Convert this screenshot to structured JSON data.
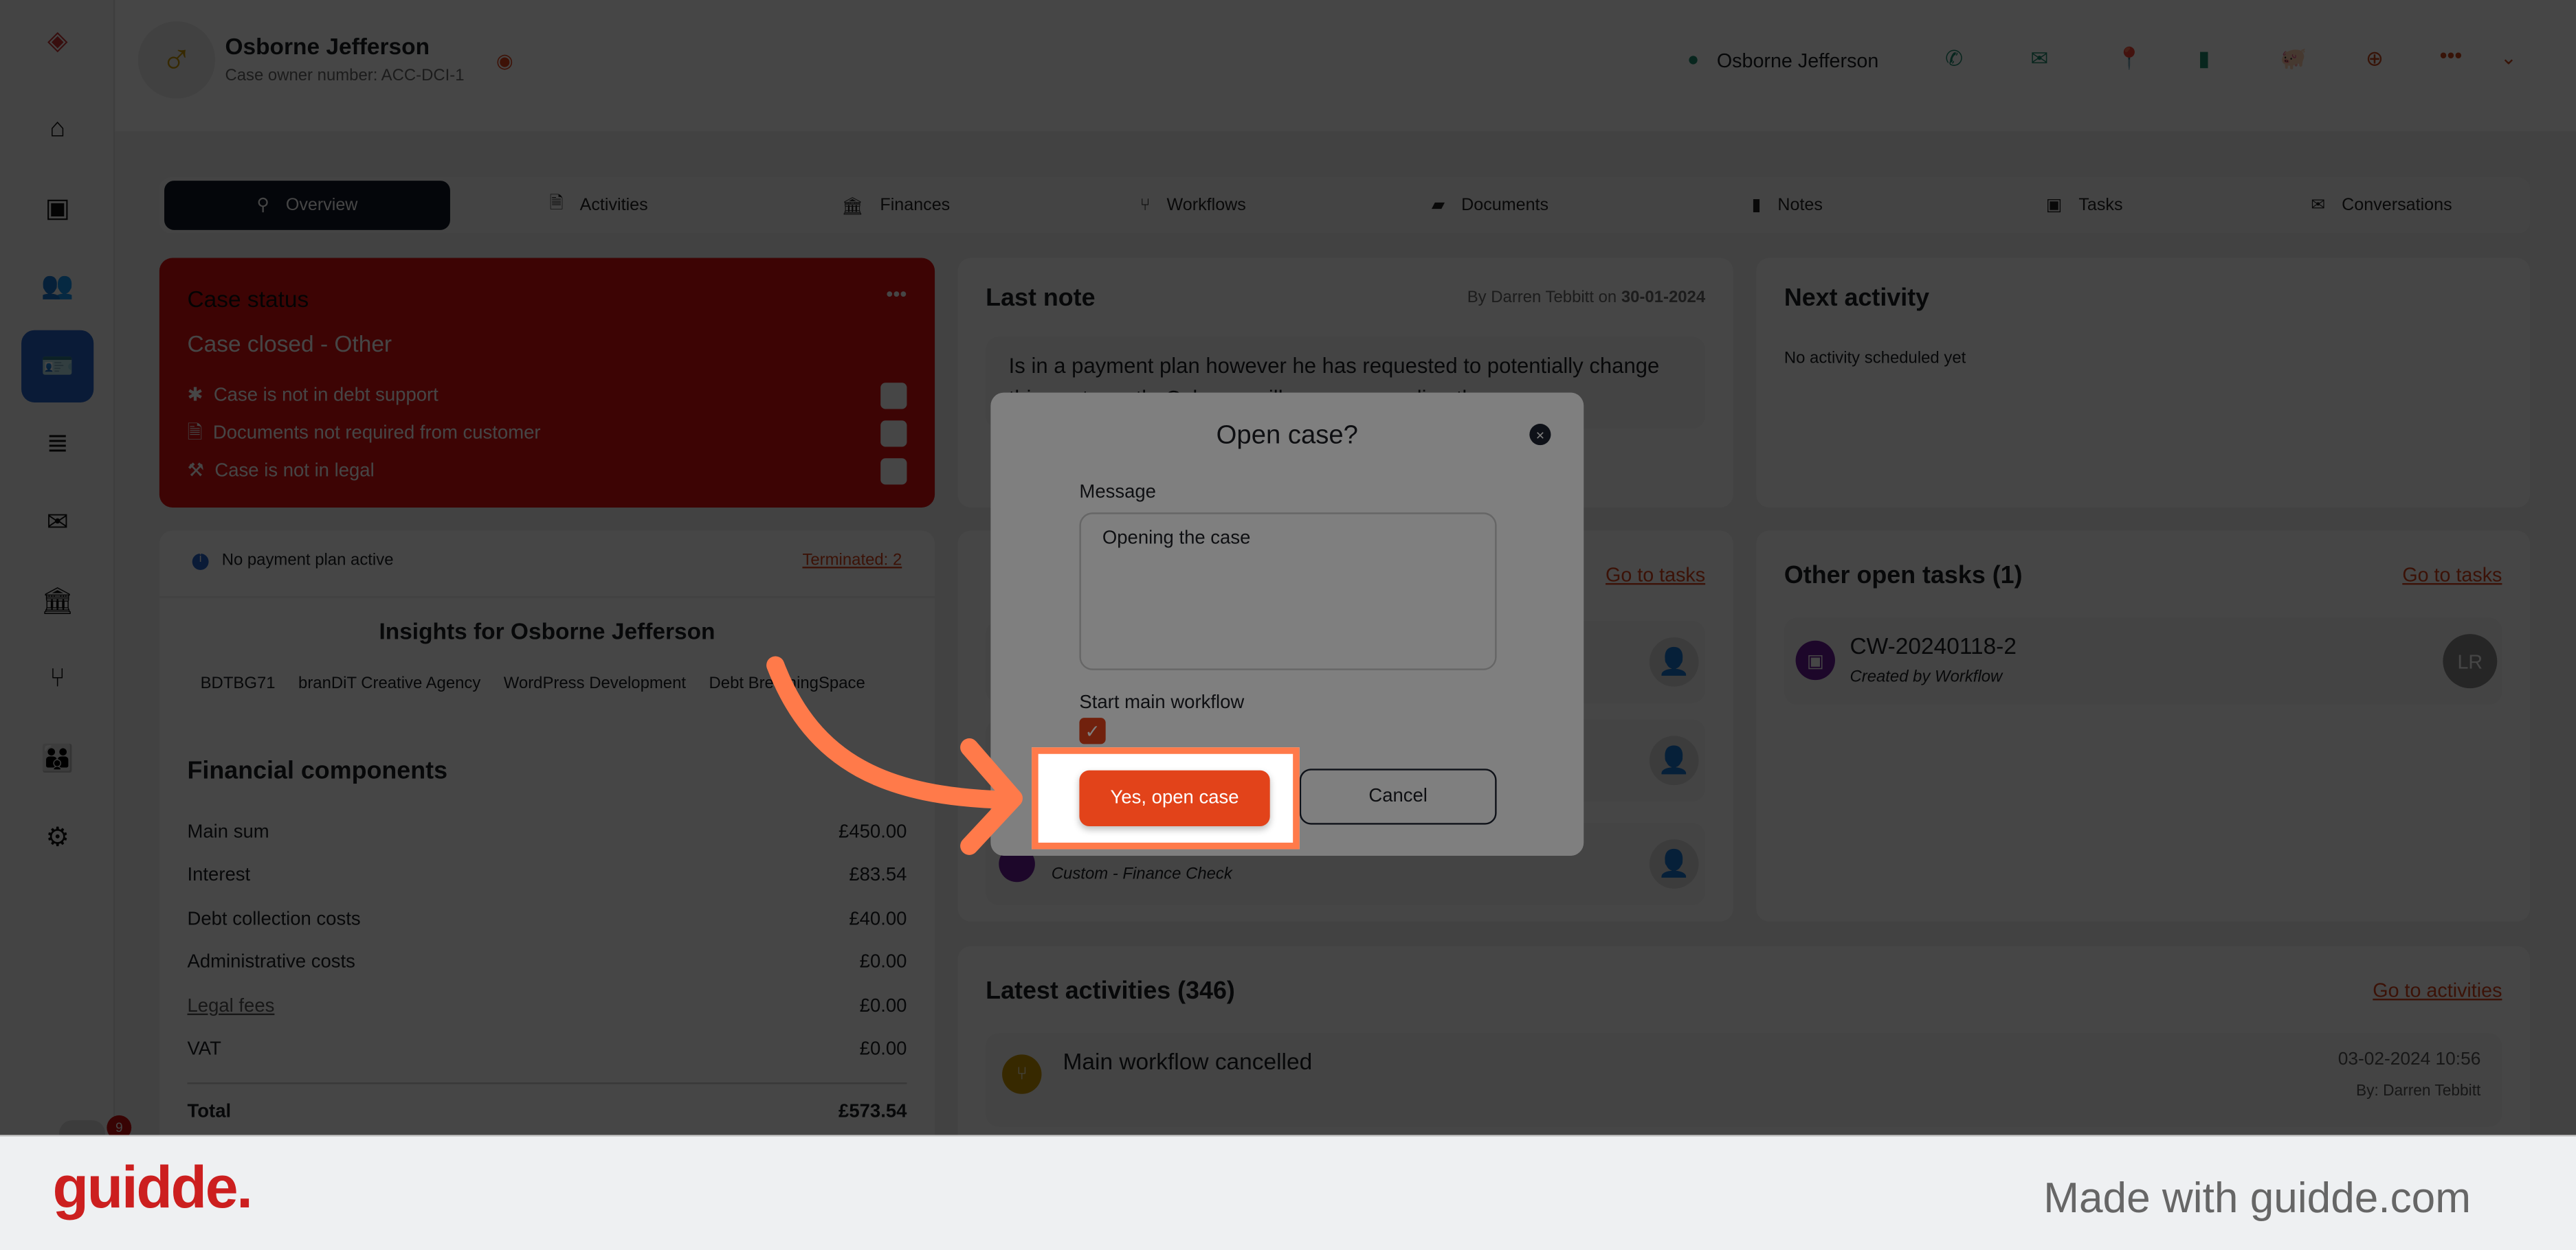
{
  "header": {
    "name": "Osborne Jefferson",
    "case_owner": "Case owner number: ACC-DCI-1",
    "contact_name": "Osborne Jefferson",
    "icons": [
      "phone-icon",
      "email-icon",
      "location-icon",
      "mobile-icon",
      "piggy-bank-icon",
      "globe-icon",
      "more-icon",
      "chevron-down-icon"
    ]
  },
  "sidebar": {
    "items": [
      "home",
      "tasks",
      "contacts",
      "cases",
      "database",
      "mail",
      "bank",
      "workflows",
      "teams",
      "settings"
    ],
    "notification_count": "9"
  },
  "tabs": [
    {
      "label": "Overview",
      "active": true
    },
    {
      "label": "Activities"
    },
    {
      "label": "Finances"
    },
    {
      "label": "Workflows"
    },
    {
      "label": "Documents"
    },
    {
      "label": "Notes"
    },
    {
      "label": "Tasks"
    },
    {
      "label": "Conversations"
    }
  ],
  "case_status": {
    "title": "Case status",
    "status": "Case closed - Other",
    "items": [
      "Case is not in debt support",
      "Documents not required from customer",
      "Case is not in legal"
    ],
    "color": "#e01010"
  },
  "payment": {
    "info": "No payment plan active",
    "terminated": "Terminated: 2",
    "insights_title": "Insights for Osborne Jefferson",
    "tags": [
      "BDTBG71",
      "branDiT Creative Agency",
      "WordPress Development",
      "Debt BreathingSpace"
    ],
    "financial_title": "Financial components",
    "rows": [
      {
        "label": "Main sum",
        "value": "£450.00"
      },
      {
        "label": "Interest",
        "value": "£83.54"
      },
      {
        "label": "Debt collection costs",
        "value": "£40.00"
      },
      {
        "label": "Administrative costs",
        "value": "£0.00"
      },
      {
        "label": "Legal fees",
        "value": "£0.00"
      },
      {
        "label": "VAT",
        "value": "£0.00"
      }
    ],
    "total_label": "Total",
    "total_value": "£573.54"
  },
  "last_note": {
    "title": "Last note",
    "by": "By Darren Tebbitt on",
    "date": "30-01-2024",
    "text": "Is in a payment plan however he has requested to potentially change this next month. Osborne will message us directly..."
  },
  "next_activity": {
    "title": "Next activity",
    "empty": "No activity scheduled yet"
  },
  "my_tasks": {
    "link": "Go to tasks",
    "last_task_sub": "Custom - Finance Check"
  },
  "other_tasks": {
    "title": "Other open tasks (1)",
    "link": "Go to tasks",
    "task_id": "CW-20240118-2",
    "task_sub": "Created by Workflow",
    "assignee": "LR"
  },
  "latest": {
    "title": "Latest activities (346)",
    "link": "Go to activities",
    "item_title": "Main workflow cancelled",
    "item_date": "03-02-2024 10:56",
    "item_by": "By: Darren Tebbitt"
  },
  "modal": {
    "title": "Open case?",
    "message_label": "Message",
    "message_value": "Opening the case",
    "workflow_label": "Start main workflow",
    "workflow_checked": true,
    "confirm": "Yes, open case",
    "cancel": "Cancel"
  },
  "footer": {
    "logo": "guidde.",
    "tagline": "Made with guidde.com"
  },
  "colors": {
    "accent": "#e2431a",
    "highlight": "#ff7a4a"
  }
}
